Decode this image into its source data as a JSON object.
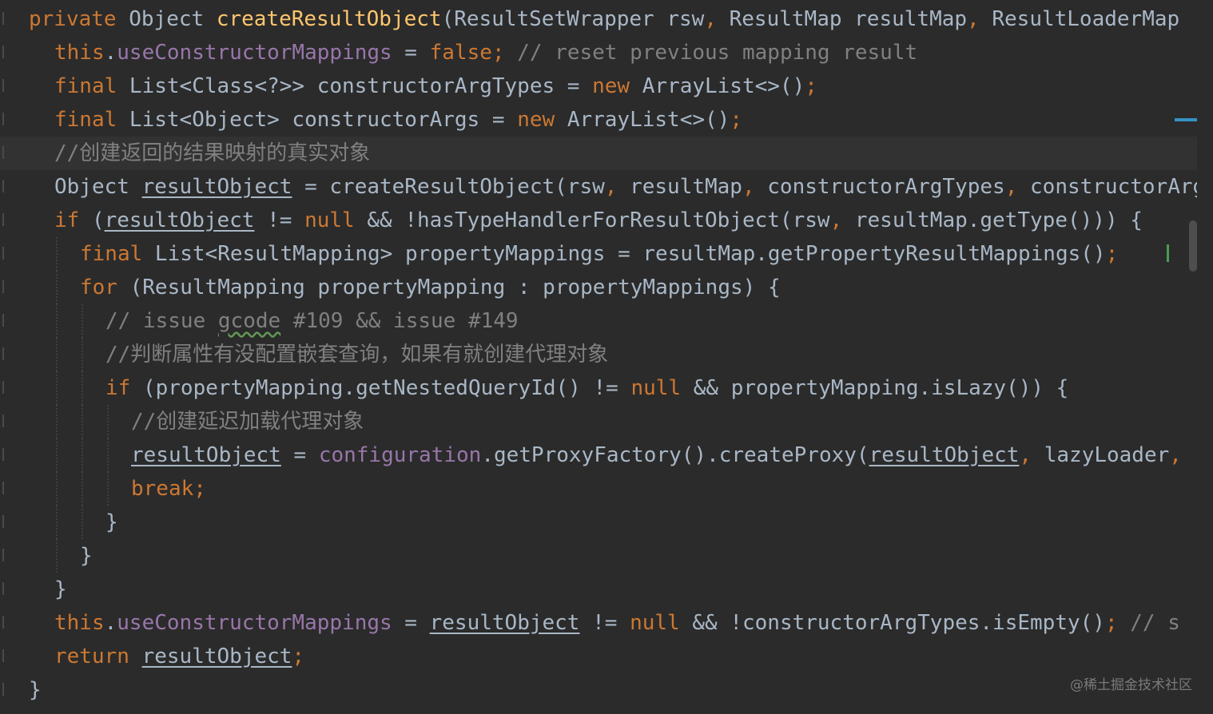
{
  "editor": {
    "lines": [
      {
        "tokens": [
          {
            "t": "private ",
            "c": "kw"
          },
          {
            "t": "Object ",
            "c": ""
          },
          {
            "t": "createResultObject",
            "c": "fn"
          },
          {
            "t": "(ResultSetWrapper rsw",
            "c": ""
          },
          {
            "t": ", ",
            "c": "kw"
          },
          {
            "t": "ResultMap resultMap",
            "c": ""
          },
          {
            "t": ", ",
            "c": "kw"
          },
          {
            "t": "ResultLoaderMap",
            "c": ""
          }
        ]
      },
      {
        "tokens": [
          {
            "t": "this",
            "c": "kw"
          },
          {
            "t": ".",
            "c": ""
          },
          {
            "t": "useConstructorMappings",
            "c": "fld"
          },
          {
            "t": " = ",
            "c": ""
          },
          {
            "t": "false",
            "c": "kw"
          },
          {
            "t": "; ",
            "c": "kw"
          },
          {
            "t": "// reset previous mapping result",
            "c": "cm"
          }
        ]
      },
      {
        "tokens": [
          {
            "t": "final ",
            "c": "kw"
          },
          {
            "t": "List<Class<?>> constructorArgTypes = ",
            "c": ""
          },
          {
            "t": "new ",
            "c": "kw"
          },
          {
            "t": "ArrayList<>()",
            "c": ""
          },
          {
            "t": ";",
            "c": "kw"
          }
        ]
      },
      {
        "tokens": [
          {
            "t": "final ",
            "c": "kw"
          },
          {
            "t": "List<Object> constructorArgs = ",
            "c": ""
          },
          {
            "t": "new ",
            "c": "kw"
          },
          {
            "t": "ArrayList<>()",
            "c": ""
          },
          {
            "t": ";",
            "c": "kw"
          }
        ]
      },
      {
        "tokens": [
          {
            "t": "//创建返回的结果映射的真实对象",
            "c": "cm"
          }
        ]
      },
      {
        "tokens": [
          {
            "t": "Object ",
            "c": ""
          },
          {
            "t": "resultObject",
            "c": "u"
          },
          {
            "t": " = createResultObject(rsw",
            "c": ""
          },
          {
            "t": ", ",
            "c": "kw"
          },
          {
            "t": "resultMap",
            "c": ""
          },
          {
            "t": ", ",
            "c": "kw"
          },
          {
            "t": "constructorArgTypes",
            "c": ""
          },
          {
            "t": ", ",
            "c": "kw"
          },
          {
            "t": "constructorArgs",
            "c": ""
          }
        ]
      },
      {
        "tokens": [
          {
            "t": "if ",
            "c": "kw"
          },
          {
            "t": "(",
            "c": ""
          },
          {
            "t": "resultObject",
            "c": "u"
          },
          {
            "t": " != ",
            "c": ""
          },
          {
            "t": "null ",
            "c": "kw"
          },
          {
            "t": "&& !hasTypeHandlerForResultObject(rsw",
            "c": ""
          },
          {
            "t": ", ",
            "c": "kw"
          },
          {
            "t": "resultMap.getType())) {",
            "c": ""
          }
        ]
      },
      {
        "tokens": [
          {
            "t": "final ",
            "c": "kw"
          },
          {
            "t": "List<ResultMapping> propertyMappings = resultMap.getPropertyResultMappings()",
            "c": ""
          },
          {
            "t": ";",
            "c": "kw"
          }
        ]
      },
      {
        "tokens": [
          {
            "t": "for ",
            "c": "kw"
          },
          {
            "t": "(ResultMapping propertyMapping : propertyMappings) {",
            "c": ""
          }
        ]
      },
      {
        "tokens": [
          {
            "t": "// issue ",
            "c": "cm"
          },
          {
            "t": "gcode",
            "c": "cm wavy"
          },
          {
            "t": " #109 && issue #149",
            "c": "cm"
          }
        ]
      },
      {
        "tokens": [
          {
            "t": "//判断属性有没配置嵌套查询，如果有就创建代理对象",
            "c": "cm"
          }
        ]
      },
      {
        "tokens": [
          {
            "t": "if ",
            "c": "kw"
          },
          {
            "t": "(propertyMapping.getNestedQueryId() != ",
            "c": ""
          },
          {
            "t": "null ",
            "c": "kw"
          },
          {
            "t": "&& propertyMapping.isLazy()) {",
            "c": ""
          }
        ]
      },
      {
        "tokens": [
          {
            "t": "//创建延迟加载代理对象",
            "c": "cm"
          }
        ]
      },
      {
        "tokens": [
          {
            "t": "resultObject",
            "c": "u"
          },
          {
            "t": " = ",
            "c": ""
          },
          {
            "t": "configuration",
            "c": "fld"
          },
          {
            "t": ".getProxyFactory().createProxy(",
            "c": ""
          },
          {
            "t": "resultObject",
            "c": "u"
          },
          {
            "t": ", ",
            "c": "kw"
          },
          {
            "t": "lazyLoader",
            "c": ""
          },
          {
            "t": ",",
            "c": "kw"
          }
        ]
      },
      {
        "tokens": [
          {
            "t": "break",
            "c": "kw"
          },
          {
            "t": ";",
            "c": "kw"
          }
        ]
      },
      {
        "tokens": [
          {
            "t": "}",
            "c": ""
          }
        ]
      },
      {
        "tokens": [
          {
            "t": "}",
            "c": ""
          }
        ]
      },
      {
        "tokens": [
          {
            "t": "}",
            "c": ""
          }
        ]
      },
      {
        "tokens": [
          {
            "t": "this",
            "c": "kw"
          },
          {
            "t": ".",
            "c": ""
          },
          {
            "t": "useConstructorMappings",
            "c": "fld"
          },
          {
            "t": " = ",
            "c": ""
          },
          {
            "t": "resultObject",
            "c": "u"
          },
          {
            "t": " != ",
            "c": ""
          },
          {
            "t": "null ",
            "c": "kw"
          },
          {
            "t": "&& !constructorArgTypes.isEmpty()",
            "c": ""
          },
          {
            "t": "; ",
            "c": "kw"
          },
          {
            "t": "// s",
            "c": "cm"
          }
        ]
      },
      {
        "tokens": [
          {
            "t": "return ",
            "c": "kw"
          },
          {
            "t": "resultObject",
            "c": "u"
          },
          {
            "t": ";",
            "c": "kw"
          }
        ]
      },
      {
        "tokens": [
          {
            "t": "}",
            "c": ""
          }
        ]
      }
    ]
  },
  "watermark": "@稀土掘金技术社区",
  "colors": {
    "background": "#2b2b2b",
    "keyword": "#cc7832",
    "function": "#ffc66d",
    "field": "#9876aa",
    "comment": "#808080",
    "text": "#a9b7c6"
  }
}
